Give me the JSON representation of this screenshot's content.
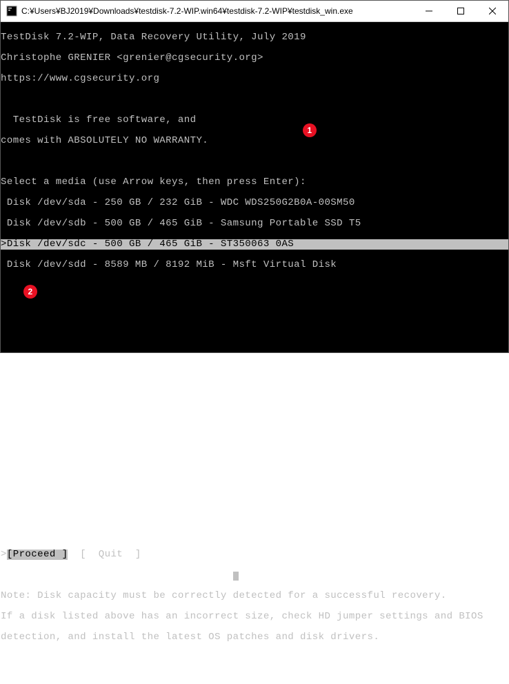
{
  "window": {
    "title": "C:¥Users¥BJ2019¥Downloads¥testdisk-7.2-WIP.win64¥testdisk-7.2-WIP¥testdisk_win.exe"
  },
  "header": {
    "line1": "TestDisk 7.2-WIP, Data Recovery Utility, July 2019",
    "line2": "Christophe GRENIER <grenier@cgsecurity.org>",
    "line3": "https://www.cgsecurity.org"
  },
  "info": {
    "line1": "  TestDisk is free software, and",
    "line2": "comes with ABSOLUTELY NO WARRANTY."
  },
  "prompt": "Select a media (use Arrow keys, then press Enter):",
  "disks": [
    {
      "text": " Disk /dev/sda - 250 GB / 232 GiB - WDC WDS250G2B0A-00SM50",
      "selected": false
    },
    {
      "text": " Disk /dev/sdb - 500 GB / 465 GiB - Samsung Portable SSD T5",
      "selected": false
    },
    {
      "text": ">Disk /dev/sdc - 500 GB / 465 GiB - ST350063 0AS",
      "selected": true
    },
    {
      "text": " Disk /dev/sdd - 8589 MB / 8192 MiB - Msft Virtual Disk",
      "selected": false
    }
  ],
  "menu": {
    "prefix": ">",
    "proceed": "[Proceed ]",
    "spacer": "  ",
    "quit": "[  Quit  ]"
  },
  "note": {
    "line1": "Note: Disk capacity must be correctly detected for a successful recovery.",
    "line2": "If a disk listed above has an incorrect size, check HD jumper settings and BIOS",
    "line3": "detection, and install the latest OS patches and disk drivers."
  },
  "badges": {
    "b1": "1",
    "b2": "2"
  }
}
